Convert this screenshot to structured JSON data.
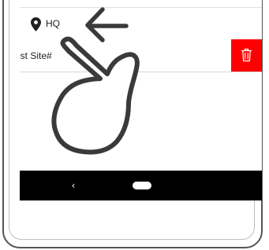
{
  "location": {
    "label": "HQ",
    "icon": "map-pin-icon"
  },
  "site_row": {
    "label": "est Site#",
    "delete_icon": "trash-icon",
    "delete_color": "#ff0000"
  },
  "nav_bar": {
    "back_glyph": "‹",
    "back_icon": "back-icon",
    "home_icon": "home-pill"
  },
  "gesture_hint": {
    "icon": "swipe-left-hand-icon",
    "arrow_icon": "left-arrow-icon"
  }
}
